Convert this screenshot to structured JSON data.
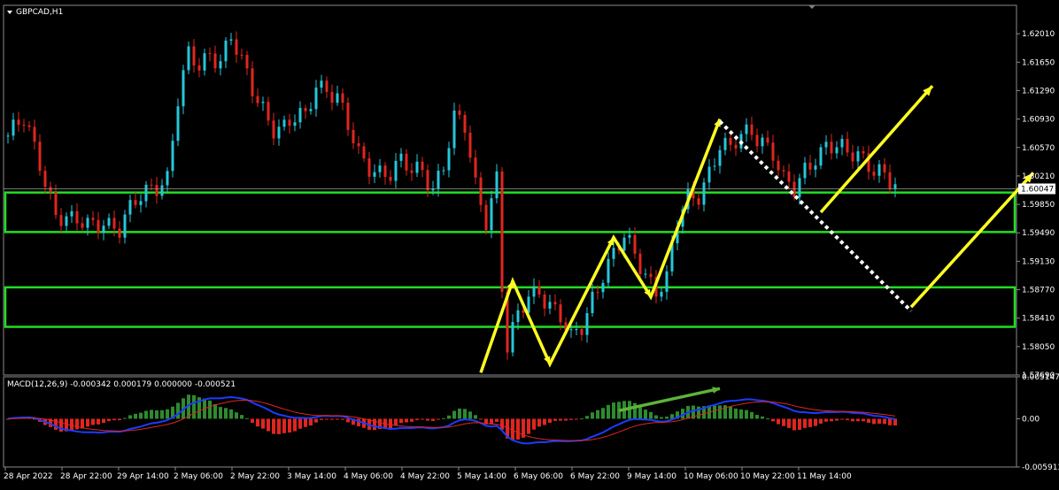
{
  "window": {
    "symbol_title": "GBPCAD,H1"
  },
  "indicator": {
    "title": "MACD(12,26,9) -0.000342 0.000179 0.000000 -0.000521"
  },
  "colors": {
    "bull": "#26c6da",
    "bear": "#e0261f",
    "hist_pos": "#2e8b2e",
    "hist_neg": "#e0261f",
    "macd_line": "#1a3cff",
    "signal_line": "#e0261f",
    "zone": "#22dd22",
    "arrow": "#ffff22",
    "dots": "#ffffff",
    "divergence": "#5db33a"
  },
  "chart_data": [
    {
      "type": "candlestick",
      "timeframe": "H1",
      "ylim": [
        1.5769,
        1.6237
      ],
      "y_ticks": [
        "1.62010",
        "1.61650",
        "1.61290",
        "1.60930",
        "1.60570",
        "1.60210",
        "1.59850",
        "1.59490",
        "1.59130",
        "1.58770",
        "1.58410",
        "1.58050",
        "1.57690"
      ],
      "current_price": "1.60047",
      "x_ticks": [
        "28 Apr 2022",
        "28 Apr 22:00",
        "29 Apr 14:00",
        "2 May 06:00",
        "2 May 22:00",
        "3 May 14:00",
        "4 May 06:00",
        "4 May 22:00",
        "5 May 14:00",
        "6 May 06:00",
        "6 May 22:00",
        "9 May 14:00",
        "10 May 06:00",
        "10 May 22:00",
        "11 May 14:00"
      ],
      "close_path": [
        [
          0,
          1.6072
        ],
        [
          3,
          1.6088
        ],
        [
          6,
          1.604
        ],
        [
          9,
          1.5975
        ],
        [
          12,
          1.596
        ],
        [
          15,
          1.5958
        ],
        [
          18,
          1.5968
        ],
        [
          21,
          1.5952
        ],
        [
          24,
          1.5985
        ],
        [
          27,
          1.601
        ],
        [
          30,
          1.602
        ],
        [
          32,
          1.6115
        ],
        [
          34,
          1.617
        ],
        [
          36,
          1.616
        ],
        [
          38,
          1.618
        ],
        [
          40,
          1.617
        ],
        [
          42,
          1.6195
        ],
        [
          44,
          1.616
        ],
        [
          46,
          1.613
        ],
        [
          48,
          1.611
        ],
        [
          50,
          1.6085
        ],
        [
          52,
          1.608
        ],
        [
          54,
          1.609
        ],
        [
          56,
          1.6095
        ],
        [
          58,
          1.614
        ],
        [
          60,
          1.6135
        ],
        [
          62,
          1.612
        ],
        [
          64,
          1.608
        ],
        [
          66,
          1.6045
        ],
        [
          68,
          1.6035
        ],
        [
          70,
          1.603
        ],
        [
          72,
          1.6025
        ],
        [
          74,
          1.6035
        ],
        [
          76,
          1.6025
        ],
        [
          78,
          1.603
        ],
        [
          80,
          1.601
        ],
        [
          82,
          1.6035
        ],
        [
          84,
          1.609
        ],
        [
          86,
          1.608
        ],
        [
          88,
          1.601
        ],
        [
          90,
          1.597
        ],
        [
          92,
          1.602
        ],
        [
          93,
          1.588
        ],
        [
          94,
          1.58
        ],
        [
          96,
          1.584
        ],
        [
          98,
          1.587
        ],
        [
          100,
          1.588
        ],
        [
          102,
          1.586
        ],
        [
          104,
          1.584
        ],
        [
          106,
          1.581
        ],
        [
          108,
          1.583
        ],
        [
          110,
          1.587
        ],
        [
          112,
          1.59
        ],
        [
          114,
          1.592
        ],
        [
          116,
          1.594
        ],
        [
          118,
          1.592
        ],
        [
          120,
          1.59
        ],
        [
          122,
          1.588
        ],
        [
          124,
          1.589
        ],
        [
          126,
          1.596
        ],
        [
          128,
          1.599
        ],
        [
          130,
          1.6
        ],
        [
          132,
          1.603
        ],
        [
          134,
          1.606
        ],
        [
          136,
          1.605
        ],
        [
          138,
          1.607
        ],
        [
          140,
          1.608
        ],
        [
          142,
          1.607
        ],
        [
          144,
          1.605
        ],
        [
          146,
          1.601
        ],
        [
          148,
          1.6
        ],
        [
          150,
          1.603
        ],
        [
          152,
          1.605
        ],
        [
          154,
          1.606
        ],
        [
          156,
          1.6055
        ],
        [
          158,
          1.6045
        ],
        [
          160,
          1.605
        ],
        [
          162,
          1.604
        ],
        [
          164,
          1.603
        ],
        [
          166,
          1.601
        ],
        [
          167,
          1.6005
        ]
      ],
      "zones": [
        [
          1.595,
          1.6
        ],
        [
          1.583,
          1.588
        ]
      ],
      "annotations": {
        "zigzag": [
          [
            89,
            1.5772
          ],
          [
            95,
            1.5888
          ],
          [
            102,
            1.5783
          ],
          [
            114,
            1.5943
          ],
          [
            121,
            1.5868
          ],
          [
            134,
            1.6093
          ]
        ],
        "dotted_drop": [
          [
            134,
            1.609
          ],
          [
            170,
            1.585
          ]
        ],
        "arrow_up_1": [
          [
            153,
            1.5975
          ],
          [
            174,
            1.6135
          ]
        ],
        "arrow_up_2": [
          [
            170,
            1.5855
          ],
          [
            193,
            1.6025
          ]
        ]
      }
    },
    {
      "type": "macd",
      "params": "12,26,9",
      "values": {
        "main": -0.000342,
        "signal": 0.000179,
        "histogram": 0.0,
        "extra": -0.000521
      },
      "ylim": [
        -0.005913,
        0.005147
      ],
      "y_ticks": [
        "0.005147",
        "0.00",
        "-0.005913"
      ],
      "divergence_line": [
        [
          115,
          0.001
        ],
        [
          134,
          0.0037
        ]
      ]
    }
  ]
}
